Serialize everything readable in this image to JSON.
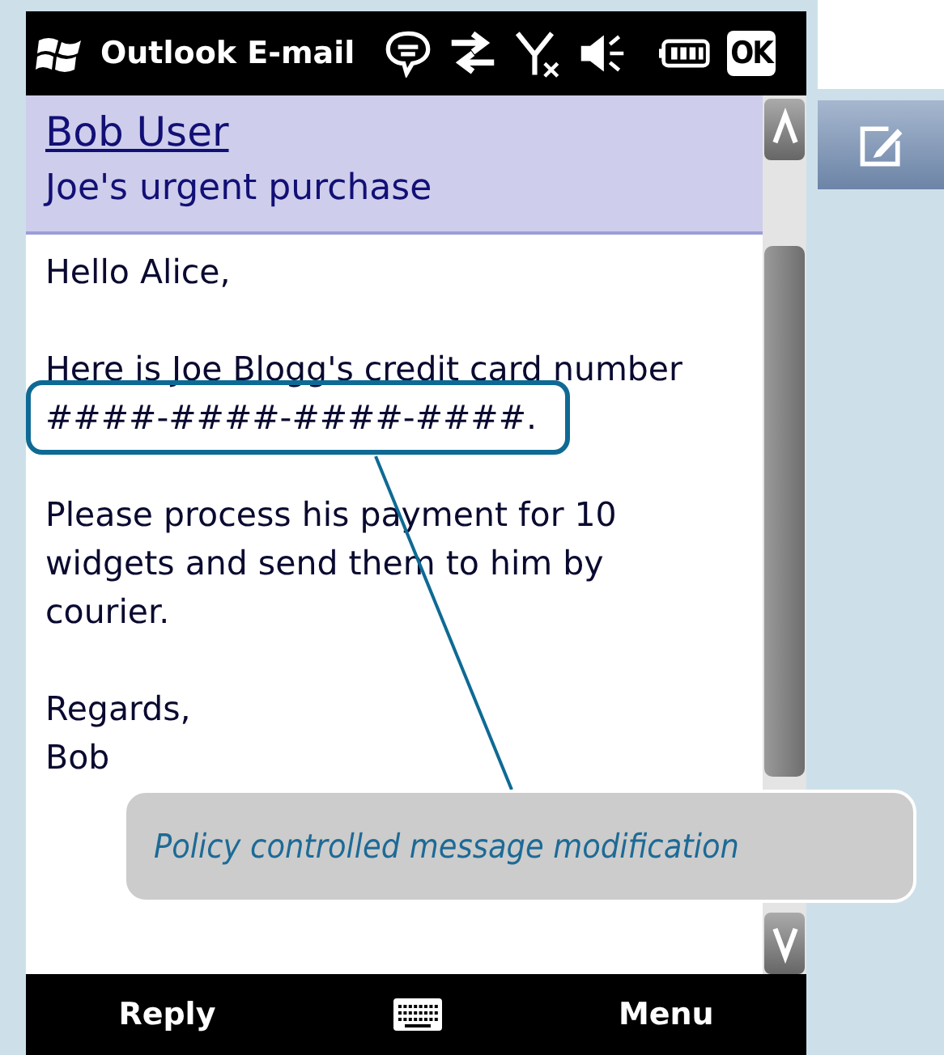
{
  "status_bar": {
    "title": "Outlook E-mail",
    "ok_button": "OK"
  },
  "message": {
    "sender": "Bob User",
    "subject": "Joe's urgent purchase",
    "paragraphs": [
      [
        {
          "text": "Hello Alice,",
          "highlighted": false
        }
      ],
      [
        {
          "text": "Here is Joe Blogg's credit card number",
          "highlighted": false
        },
        {
          "text": "####-####-####-####.",
          "highlighted": true
        }
      ],
      [
        {
          "text": "Please process his payment for 10",
          "highlighted": false
        },
        {
          "text": "widgets and send them to him by",
          "highlighted": false
        },
        {
          "text": "courier.",
          "highlighted": false
        }
      ],
      [
        {
          "text": "Regards,",
          "highlighted": false
        },
        {
          "text": "Bob",
          "highlighted": false
        }
      ]
    ]
  },
  "callout": {
    "text": "Policy controlled message modification"
  },
  "softkeys": {
    "left": "Reply",
    "right": "Menu"
  }
}
